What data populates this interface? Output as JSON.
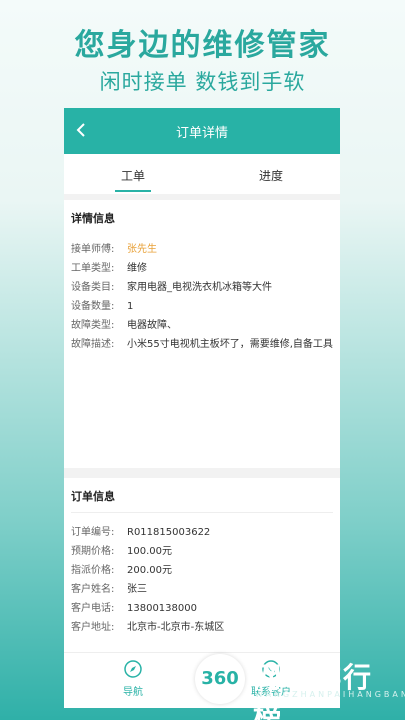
{
  "promo": {
    "title": "您身边的维修管家",
    "subtitle": "闲时接单 数钱到手软"
  },
  "nav": {
    "title": "订单详情",
    "back_icon": "chevron-left-icon"
  },
  "tabs": [
    {
      "label": "工单",
      "active": true
    },
    {
      "label": "进度",
      "active": false
    }
  ],
  "details": {
    "title": "详情信息",
    "rows": [
      {
        "key": "接单师傅:",
        "value": "张先生"
      },
      {
        "key": "工单类型:",
        "value": "维修"
      },
      {
        "key": "设备类目:",
        "value": "家用电器_电视洗衣机冰箱等大件"
      },
      {
        "key": "设备数量:",
        "value": "1"
      },
      {
        "key": "故障类型:",
        "value": "电器故障、"
      },
      {
        "key": "故障描述:",
        "value": "小米55寸电视机主板坏了，需要维修,自备工具"
      }
    ],
    "accent_color": "#e8a23a"
  },
  "order": {
    "title": "订单信息",
    "rows": [
      {
        "key": "订单编号:",
        "value": "R011815003622"
      },
      {
        "key": "预期价格:",
        "value": "100.00元"
      },
      {
        "key": "指派价格:",
        "value": "200.00元"
      },
      {
        "key": "客户姓名:",
        "value": "张三"
      },
      {
        "key": "客户电话:",
        "value": "13800138000"
      },
      {
        "key": "客户地址:",
        "value": "北京市-北京市-东城区"
      }
    ]
  },
  "actions": {
    "navigate": {
      "label": "导航",
      "icon": "compass-icon"
    },
    "contact": {
      "label": "联系客户",
      "icon": "phone-icon"
    }
  },
  "watermark": {
    "logo": "360",
    "text": "网站排行榜",
    "sub": "WANGZHANPAIHANGBANG"
  },
  "colors": {
    "brand": "#28b2a6"
  }
}
